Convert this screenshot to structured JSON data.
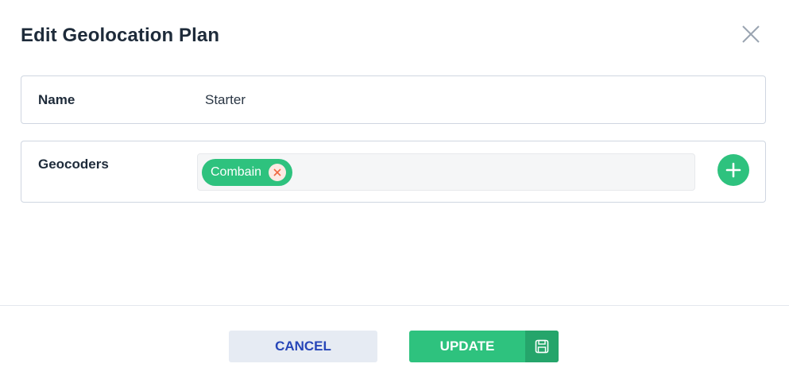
{
  "dialog": {
    "title": "Edit Geolocation Plan",
    "close_icon": "close-icon"
  },
  "fields": {
    "name": {
      "label": "Name",
      "value": "Starter"
    },
    "geocoders": {
      "label": "Geocoders",
      "tags": [
        {
          "label": "Combain",
          "remove_icon": "x-icon"
        }
      ],
      "add_icon": "plus-icon"
    }
  },
  "footer": {
    "cancel_label": "CANCEL",
    "update_label": "UPDATE",
    "update_icon": "save-icon"
  },
  "colors": {
    "accent_green": "#2ec27e",
    "accent_green_dark": "#25a56b",
    "cancel_bg": "#e6ebf3",
    "cancel_text": "#2746b8",
    "remove_x": "#f0673f"
  }
}
